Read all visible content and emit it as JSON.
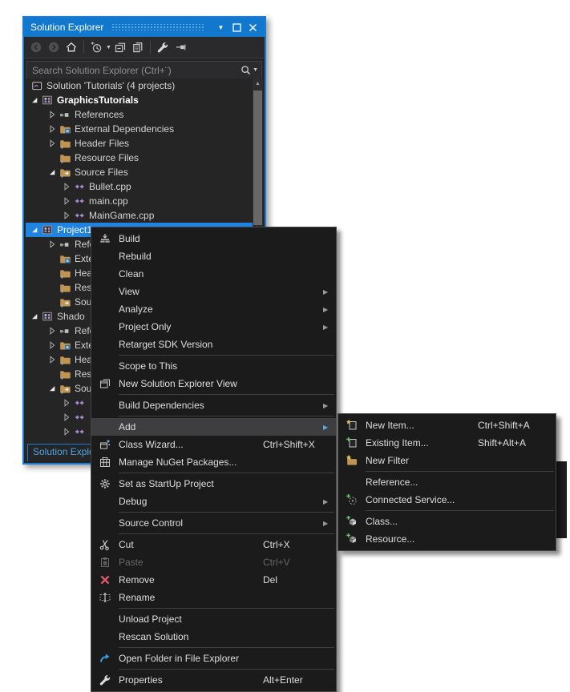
{
  "colors": {
    "accent_blue": "#1278ce",
    "panel_border": "#1c7cd1",
    "selection": "#2083df",
    "panel_bg": "#252526",
    "menu_bg": "#1b1b1c",
    "folder_tan": "#c09553",
    "cpp_purple": "#b287d6",
    "remove_red": "#e25a67",
    "link_blue": "#3c9cdf"
  },
  "panel": {
    "title": "Solution Explorer",
    "titlebar_buttons": [
      {
        "name": "window-position-menu-button",
        "icon": "chevron-down-icon"
      },
      {
        "name": "maximize-button",
        "icon": "maximize-icon"
      },
      {
        "name": "close-button",
        "icon": "close-icon"
      }
    ],
    "toolbar": [
      {
        "type": "button",
        "name": "back-button",
        "icon": "circle-arrow-left-icon"
      },
      {
        "type": "button",
        "name": "forward-button",
        "icon": "circle-arrow-right-icon"
      },
      {
        "type": "button",
        "name": "home-button",
        "icon": "home-icon"
      },
      {
        "type": "sep"
      },
      {
        "type": "button",
        "name": "pending-changes-filter-button",
        "icon": "clock-filter-icon",
        "caret": true
      },
      {
        "type": "button",
        "name": "collapse-all-button",
        "icon": "collapse-all-icon"
      },
      {
        "type": "button",
        "name": "show-all-files-button",
        "icon": "show-all-files-icon"
      },
      {
        "type": "sep"
      },
      {
        "type": "button",
        "name": "properties-button",
        "icon": "wrench-icon"
      },
      {
        "type": "button",
        "name": "preview-selected-button",
        "icon": "pin-sideways-icon"
      }
    ],
    "search": {
      "placeholder": "Search Solution Explorer (Ctrl+¨)",
      "icon": "search-icon"
    },
    "tab_label": "Solution Explorer"
  },
  "tree": {
    "rows": [
      {
        "label": "Solution 'Tutorials' (4 projects)",
        "level": 0,
        "expander": "none",
        "icon": "solution-icon"
      },
      {
        "label": "GraphicsTutorials",
        "level": 1,
        "expander": "expanded",
        "icon": "project-icon",
        "bold": true
      },
      {
        "label": "References",
        "level": 2,
        "expander": "collapsed",
        "icon": "references-icon"
      },
      {
        "label": "External Dependencies",
        "level": 2,
        "expander": "collapsed",
        "icon": "external-deps-folder-icon"
      },
      {
        "label": "Header Files",
        "level": 2,
        "expander": "collapsed",
        "icon": "filter-folder-icon"
      },
      {
        "label": "Resource Files",
        "level": 2,
        "expander": "none",
        "icon": "filter-folder-icon"
      },
      {
        "label": "Source Files",
        "level": 2,
        "expander": "expanded",
        "icon": "source-folder-icon"
      },
      {
        "label": "Bullet.cpp",
        "level": 3,
        "expander": "collapsed",
        "icon": "cpp-file-icon"
      },
      {
        "label": "main.cpp",
        "level": 3,
        "expander": "collapsed",
        "icon": "cpp-file-icon"
      },
      {
        "label": "MainGame.cpp",
        "level": 3,
        "expander": "collapsed",
        "icon": "cpp-file-icon"
      },
      {
        "label": "Project1",
        "level": 1,
        "expander": "expanded",
        "icon": "project-icon",
        "selected": true
      },
      {
        "label": "References",
        "level": 2,
        "expander": "collapsed",
        "icon": "references-icon"
      },
      {
        "label": "External Dependencies",
        "level": 2,
        "expander": "none",
        "icon": "external-deps-folder-icon"
      },
      {
        "label": "Header Files",
        "level": 2,
        "expander": "none",
        "icon": "filter-folder-icon"
      },
      {
        "label": "Resource Files",
        "level": 2,
        "expander": "none",
        "icon": "filter-folder-icon"
      },
      {
        "label": "Source Files",
        "level": 2,
        "expander": "none",
        "icon": "source-folder-icon"
      },
      {
        "label": "Shado",
        "level": 1,
        "expander": "expanded",
        "icon": "project-icon"
      },
      {
        "label": "References",
        "level": 2,
        "expander": "collapsed",
        "icon": "references-icon"
      },
      {
        "label": "External Dependencies",
        "level": 2,
        "expander": "collapsed",
        "icon": "external-deps-folder-icon"
      },
      {
        "label": "Header Files",
        "level": 2,
        "expander": "collapsed",
        "icon": "filter-folder-icon"
      },
      {
        "label": "Resource Files",
        "level": 2,
        "expander": "none",
        "icon": "filter-folder-icon"
      },
      {
        "label": "Source Files",
        "level": 2,
        "expander": "expanded",
        "icon": "source-folder-icon"
      },
      {
        "label": "",
        "level": 3,
        "expander": "collapsed",
        "icon": "cpp-file-icon"
      },
      {
        "label": "",
        "level": 3,
        "expander": "collapsed",
        "icon": "cpp-file-icon"
      },
      {
        "label": "",
        "level": 3,
        "expander": "collapsed",
        "icon": "cpp-file-icon"
      },
      {
        "label": "",
        "level": 3,
        "expander": "collapsed",
        "icon": "cpp-file-icon"
      }
    ]
  },
  "context_menu": {
    "items": [
      {
        "label": "Build",
        "icon": "build-icon"
      },
      {
        "label": "Rebuild"
      },
      {
        "label": "Clean"
      },
      {
        "label": "View",
        "submenu": true
      },
      {
        "label": "Analyze",
        "submenu": true
      },
      {
        "label": "Project Only",
        "submenu": true
      },
      {
        "label": "Retarget SDK Version"
      },
      {
        "type": "separator"
      },
      {
        "label": "Scope to This"
      },
      {
        "label": "New Solution Explorer View",
        "icon": "new-view-icon"
      },
      {
        "type": "separator"
      },
      {
        "label": "Build Dependencies",
        "submenu": true
      },
      {
        "type": "separator"
      },
      {
        "label": "Add",
        "submenu": true,
        "highlighted": true
      },
      {
        "label": "Class Wizard...",
        "icon": "class-wizard-icon",
        "shortcut": "Ctrl+Shift+X"
      },
      {
        "label": "Manage NuGet Packages...",
        "icon": "nuget-icon"
      },
      {
        "type": "separator"
      },
      {
        "label": "Set as StartUp Project",
        "icon": "gear-icon"
      },
      {
        "label": "Debug",
        "submenu": true
      },
      {
        "type": "separator"
      },
      {
        "label": "Source Control",
        "submenu": true
      },
      {
        "type": "separator"
      },
      {
        "label": "Cut",
        "icon": "scissors-icon",
        "shortcut": "Ctrl+X"
      },
      {
        "label": "Paste",
        "icon": "paste-icon",
        "shortcut": "Ctrl+V",
        "disabled": true
      },
      {
        "label": "Remove",
        "icon": "remove-x-icon",
        "shortcut": "Del"
      },
      {
        "label": "Rename",
        "icon": "rename-icon"
      },
      {
        "type": "separator"
      },
      {
        "label": "Unload Project"
      },
      {
        "label": "Rescan Solution"
      },
      {
        "type": "separator"
      },
      {
        "label": "Open Folder in File Explorer",
        "icon": "open-folder-icon"
      },
      {
        "type": "separator"
      },
      {
        "label": "Properties",
        "icon": "wrench-icon",
        "shortcut": "Alt+Enter"
      }
    ]
  },
  "add_submenu": {
    "items": [
      {
        "label": "New Item...",
        "icon": "new-item-icon",
        "shortcut": "Ctrl+Shift+A"
      },
      {
        "label": "Existing Item...",
        "icon": "existing-item-icon",
        "shortcut": "Shift+Alt+A"
      },
      {
        "label": "New Filter",
        "icon": "new-filter-icon"
      },
      {
        "type": "separator"
      },
      {
        "label": "Reference..."
      },
      {
        "label": "Connected Service...",
        "icon": "connected-service-icon"
      },
      {
        "type": "separator"
      },
      {
        "label": "Class...",
        "icon": "class-icon"
      },
      {
        "label": "Resource...",
        "icon": "resource-icon"
      }
    ]
  }
}
